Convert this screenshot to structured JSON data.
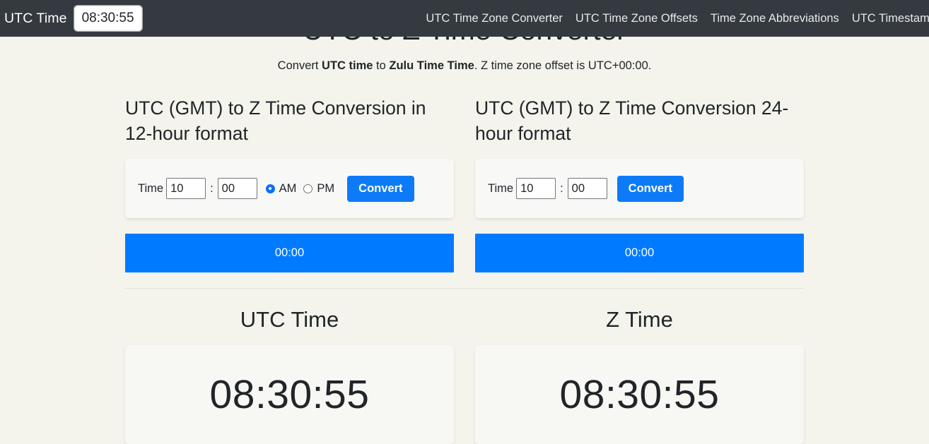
{
  "navbar": {
    "brand": "UTC Time",
    "current_time": "08:30:55",
    "links": [
      {
        "label": "UTC Time Zone Converter"
      },
      {
        "label": "UTC Time Zone Offsets"
      },
      {
        "label": "Time Zone Abbreviations"
      },
      {
        "label": "UTC Timestamp"
      }
    ]
  },
  "header": {
    "title": "UTC to Z Time Converter",
    "subtitle_part1": "Convert ",
    "subtitle_bold1": "UTC time",
    "subtitle_part2": " to ",
    "subtitle_bold2": "Zulu Time Time",
    "subtitle_part3": ". Z time zone offset is UTC+00:00."
  },
  "converter_12h": {
    "heading": "UTC (GMT) to Z Time Conversion in 12-hour format",
    "time_label": "Time",
    "hour_value": "10",
    "separator": ":",
    "minute_value": "00",
    "am_label": "AM",
    "pm_label": "PM",
    "selected_meridiem": "AM",
    "convert_label": "Convert",
    "result": "00:00"
  },
  "converter_24h": {
    "heading": "UTC (GMT) to Z Time Conversion 24-hour format",
    "time_label": "Time",
    "hour_value": "10",
    "separator": ":",
    "minute_value": "00",
    "convert_label": "Convert",
    "result": "00:00"
  },
  "clocks": {
    "left": {
      "heading": "UTC Time",
      "value": "08:30:55"
    },
    "right": {
      "heading": "Z Time",
      "value": "08:30:55"
    }
  },
  "colors": {
    "navbar_bg": "#343a40",
    "page_bg": "#f4f4ec",
    "accent_blue": "#007bff",
    "button_blue": "#0d7bf7",
    "text": "#212529"
  }
}
